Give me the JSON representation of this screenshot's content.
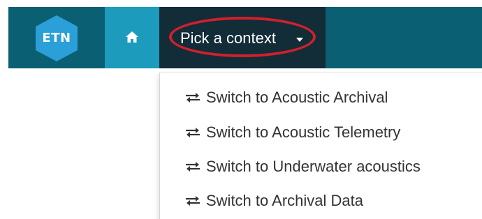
{
  "logo": {
    "text": "ETN"
  },
  "nav": {
    "home_icon": "home-icon",
    "context_label": "Pick a context"
  },
  "dropdown": {
    "items": [
      {
        "icon": "exchange-icon",
        "label": "Switch to Acoustic Archival"
      },
      {
        "icon": "exchange-icon",
        "label": "Switch to Acoustic Telemetry"
      },
      {
        "icon": "exchange-icon",
        "label": "Switch to Underwater acoustics"
      },
      {
        "icon": "exchange-icon",
        "label": "Switch to Archival Data"
      }
    ]
  },
  "colors": {
    "navbar": "#0a5f73",
    "home_active": "#1c9bbd",
    "context_bg": "#122c38",
    "logo_hex": "#2a9fd8",
    "highlight": "#d0202c",
    "menu_text": "#333333"
  }
}
